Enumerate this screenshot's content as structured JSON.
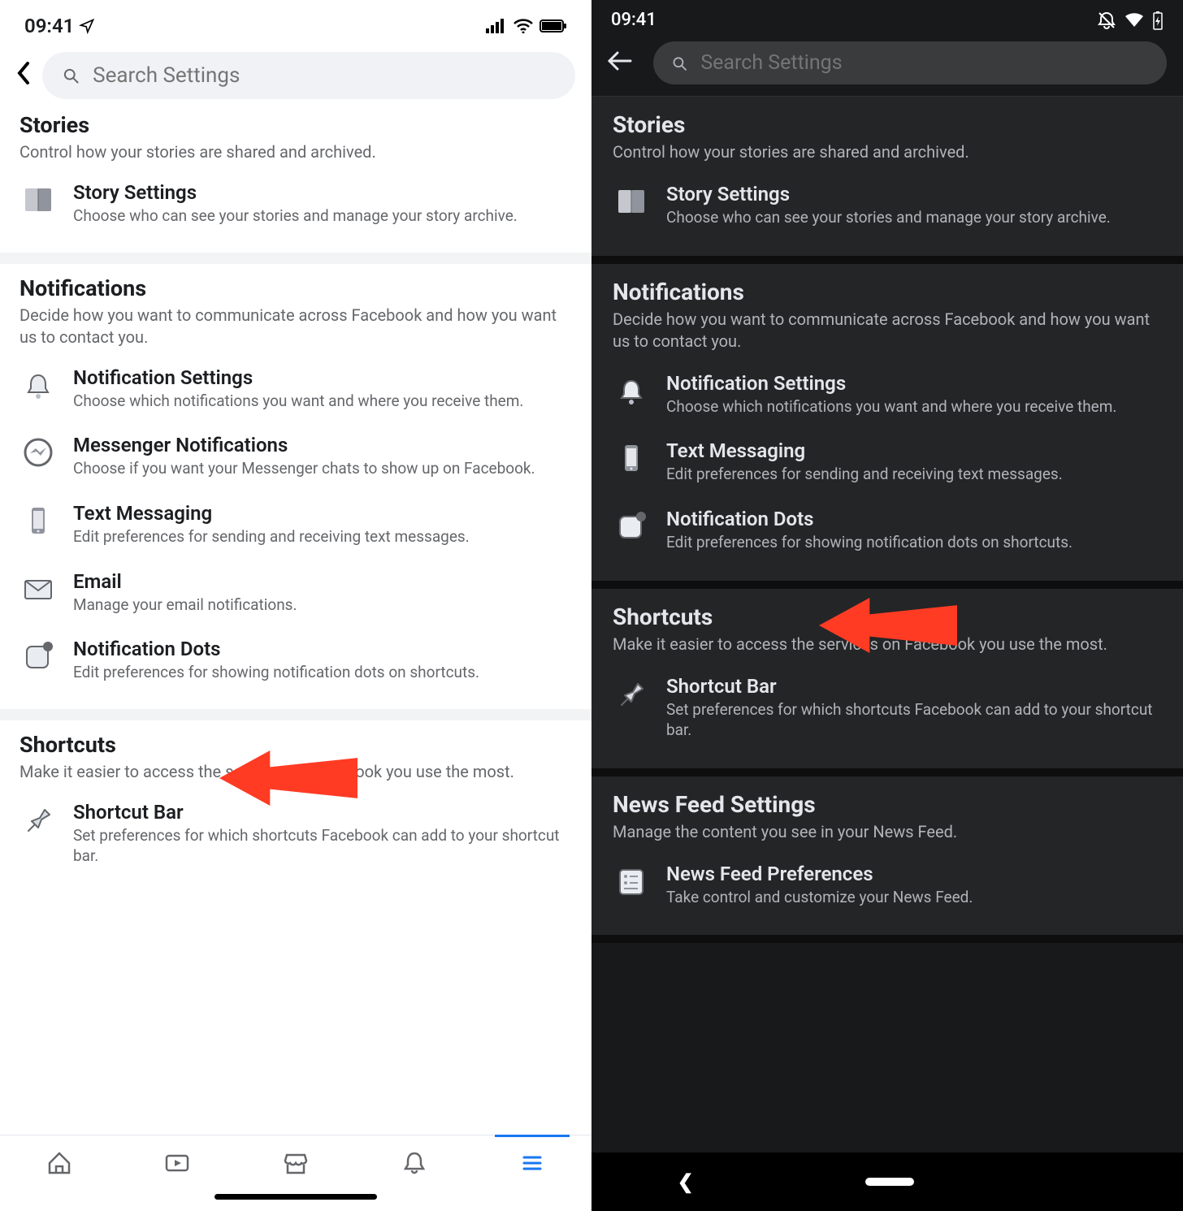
{
  "time": "09:41",
  "search_placeholder": "Search Settings",
  "light": {
    "sections": [
      {
        "title": "Stories",
        "sub": "Control how your stories are shared and archived.",
        "items": [
          {
            "icon": "book-icon",
            "label": "Story Settings",
            "sub": "Choose who can see your stories and manage your story archive."
          }
        ]
      },
      {
        "title": "Notifications",
        "sub": "Decide how you want to communicate across Facebook and how you want us to contact you.",
        "items": [
          {
            "icon": "bell-icon",
            "label": "Notification Settings",
            "sub": "Choose which notifications you want and where you receive them."
          },
          {
            "icon": "messenger-icon",
            "label": "Messenger Notifications",
            "sub": "Choose if you want your Messenger chats to show up on Facebook."
          },
          {
            "icon": "phone-icon",
            "label": "Text Messaging",
            "sub": "Edit preferences for sending and receiving text messages."
          },
          {
            "icon": "mail-icon",
            "label": "Email",
            "sub": "Manage your email notifications."
          },
          {
            "icon": "dot-square-icon",
            "label": "Notification Dots",
            "sub": "Edit preferences for showing notification dots on shortcuts."
          }
        ]
      },
      {
        "title": "Shortcuts",
        "sub": "Make it easier to access the services on Facebook you use the most.",
        "items": [
          {
            "icon": "pin-icon",
            "label": "Shortcut Bar",
            "sub": "Set preferences for which shortcuts Facebook can add to your shortcut bar."
          }
        ]
      }
    ]
  },
  "dark": {
    "sections": [
      {
        "title": "Stories",
        "sub": "Control how your stories are shared and archived.",
        "items": [
          {
            "icon": "book-icon",
            "label": "Story Settings",
            "sub": "Choose who can see your stories and manage your story archive."
          }
        ]
      },
      {
        "title": "Notifications",
        "sub": "Decide how you want to communicate across Facebook and how you want us to contact you.",
        "items": [
          {
            "icon": "bell-icon",
            "label": "Notification Settings",
            "sub": "Choose which notifications you want and where you receive them."
          },
          {
            "icon": "phone-icon",
            "label": "Text Messaging",
            "sub": "Edit preferences for sending and receiving text messages."
          },
          {
            "icon": "dot-square-icon",
            "label": "Notification Dots",
            "sub": "Edit preferences for showing notification dots on shortcuts."
          }
        ]
      },
      {
        "title": "Shortcuts",
        "sub": "Make it easier to access the services on Facebook you use the most.",
        "items": [
          {
            "icon": "pin-icon",
            "label": "Shortcut Bar",
            "sub": "Set preferences for which shortcuts Facebook can add to your shortcut bar."
          }
        ]
      },
      {
        "title": "News Feed Settings",
        "sub": "Manage the content you see in your News Feed.",
        "items": [
          {
            "icon": "feed-icon",
            "label": "News Feed Preferences",
            "sub": "Take control and customize your News Feed."
          }
        ]
      }
    ]
  }
}
